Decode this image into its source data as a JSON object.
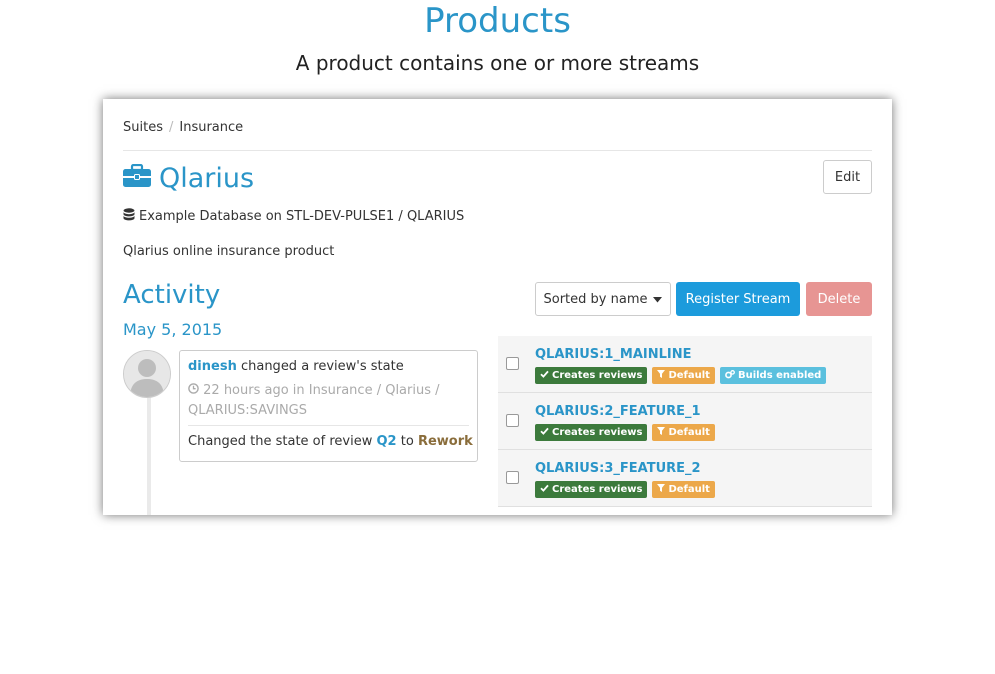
{
  "page": {
    "heading": "Products",
    "subheading": "A product contains one or more streams"
  },
  "breadcrumb": {
    "items": [
      "Suites",
      "Insurance"
    ],
    "separator": "/"
  },
  "product": {
    "name": "Qlarius",
    "database": "Example Database on STL-DEV-PULSE1 / QLARIUS",
    "description": "Qlarius online insurance product",
    "edit_label": "Edit"
  },
  "activity": {
    "title": "Activity",
    "date": "May 5, 2015",
    "entry": {
      "user": "dinesh",
      "action": "changed a review's state",
      "time": "22 hours ago in Insurance / Qlarius /",
      "path": "QLARIUS:SAVINGS",
      "detail_prefix": "Changed the state of review",
      "review": "Q2",
      "detail_to": "to",
      "new_state": "Rework"
    }
  },
  "toolbar": {
    "sort_label": "Sorted by name",
    "register_label": "Register Stream",
    "delete_label": "Delete"
  },
  "streams": [
    {
      "name": "QLARIUS:1_MAINLINE",
      "badges": [
        "Creates reviews",
        "Default",
        "Builds enabled"
      ]
    },
    {
      "name": "QLARIUS:2_FEATURE_1",
      "badges": [
        "Creates reviews",
        "Default"
      ]
    },
    {
      "name": "QLARIUS:3_FEATURE_2",
      "badges": [
        "Creates reviews",
        "Default"
      ]
    }
  ],
  "colors": {
    "accent": "#2a95c8",
    "primary_button": "#1c9bdc",
    "danger_button": "#e79593",
    "badge_green": "#3c7a3c",
    "badge_orange": "#eca84a",
    "badge_blue": "#5bc0de",
    "state_text": "#8a6d3b"
  },
  "icons": {
    "product": "briefcase-icon",
    "database": "database-icon",
    "time": "clock-icon",
    "sort": "caret-down-icon",
    "creates_reviews": "check-icon",
    "default": "filter-icon",
    "builds": "gears-icon",
    "avatar": "user-silhouette-icon"
  }
}
